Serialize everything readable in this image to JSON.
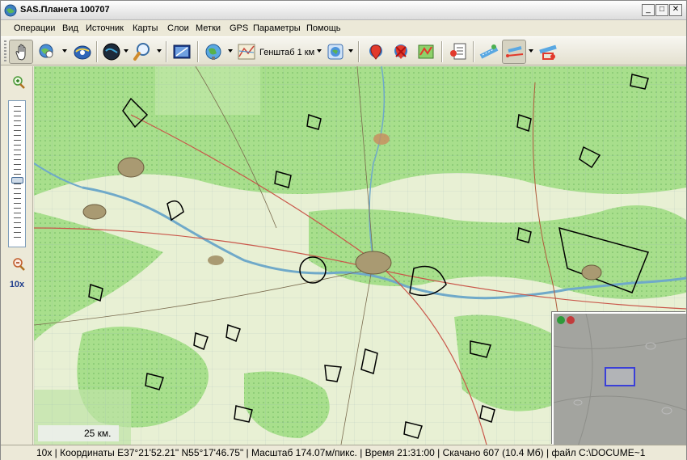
{
  "window": {
    "title": "SAS.Планета 100707",
    "controls": [
      "_",
      "□",
      "✕"
    ]
  },
  "menu": {
    "items": [
      "Операции",
      "Вид",
      "Источник",
      "Карты",
      "Слои",
      "Метки",
      "GPS",
      "Параметры",
      "Помощь"
    ]
  },
  "toolbar": {
    "map_type_label": "Генштаб 1 км",
    "icons": [
      "hand-icon",
      "globe-search-icon",
      "satellite-icon",
      "dark-globe-icon",
      "magnifier-icon",
      "fullscreen-icon",
      "world-icon",
      "genshtab-map-icon",
      "layers-icon",
      "pin-red-icon",
      "pin-cross-icon",
      "pin-path-icon",
      "marks-list-icon",
      "route-icon",
      "line-measure-icon",
      "polygon-select-icon"
    ]
  },
  "zoom": {
    "level": "10x",
    "level_fraction": 0.55
  },
  "map": {
    "scale_label": "25 км."
  },
  "statusbar": {
    "text": "10x | Координаты E37°21'52.21\" N55°17'46.75\" | Масштаб 174.07м/пикс. | Время 21:31:00 | Скачано 607 (10.4 Мб) | файл C:\\DOCUME~1"
  },
  "colors": {
    "map_green": "#9fd98a",
    "map_light": "#eef4dc",
    "river": "#6fa9c9",
    "road": "#c9574a",
    "minimap_frame": "#3a3fd8"
  }
}
